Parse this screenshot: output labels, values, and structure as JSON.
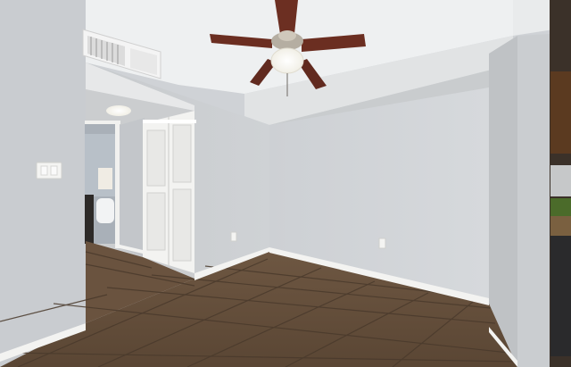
{
  "scene": {
    "description_free": true,
    "colors": {
      "wall_light": "#d3d6da",
      "wall_mid": "#c6c9cd",
      "wall_shadow": "#b4b8bc",
      "ceiling": "#eceeef",
      "baseboard": "#f4f4f2",
      "floor_dark": "#5e4a38",
      "floor_mid": "#735c46",
      "floor_light": "#8a7258",
      "grout": "#4b3b2d",
      "door_white": "#f2f2f0",
      "fan_blade": "#6b2e22",
      "fan_metal": "#b9b3a8",
      "cabinet": "#5a3a22"
    }
  }
}
